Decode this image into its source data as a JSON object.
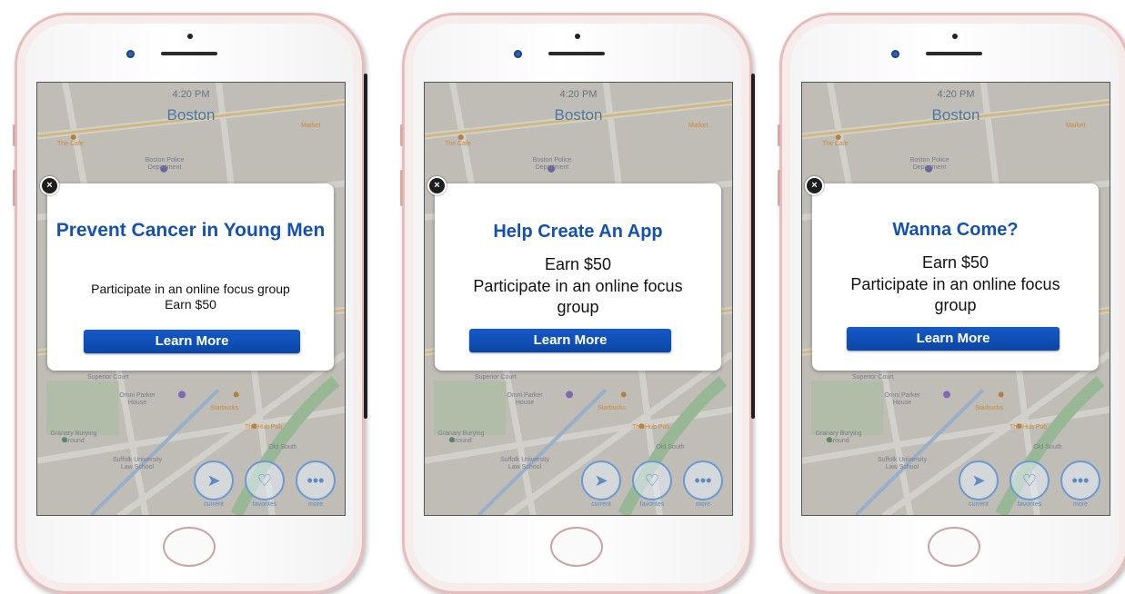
{
  "phones": [
    {
      "status": {
        "time": "4:20 PM",
        "city": "Boston"
      },
      "popup": {
        "close_icon": "close-icon",
        "headline": "Prevent Cancer in Young Men",
        "line1": "Participate in an online focus group",
        "line2": "Earn $50",
        "cta": "Learn More"
      }
    },
    {
      "status": {
        "time": "4:20 PM",
        "city": "Boston"
      },
      "popup": {
        "close_icon": "close-icon",
        "headline": "Help Create An App",
        "line1": "Earn $50",
        "line2": "Participate in an online focus group",
        "cta": "Learn More"
      }
    },
    {
      "status": {
        "time": "4:20 PM",
        "city": "Boston"
      },
      "popup": {
        "close_icon": "close-icon",
        "headline": "Wanna Come?",
        "line1": "Earn $50",
        "line2": "Participate in an online focus group",
        "cta": "Learn More"
      }
    }
  ],
  "map_labels": {
    "cafe": "The Cafe",
    "police": "Boston Police Department",
    "market": "Market",
    "court": "Superior Court",
    "omni": "Omni Parker House",
    "starbucks": "Starbucks",
    "hub": "The Hub Pub",
    "granary": "Granary Burying Ground",
    "suffolk": "Suffolk University Law School",
    "old_south": "Old South"
  },
  "tabbar": {
    "current_label": "current",
    "favorites_label": "favorites",
    "more_label": "more",
    "icons": [
      "location-arrow-icon",
      "heart-icon",
      "more-dots-icon"
    ]
  },
  "colors": {
    "headline_blue": "#1451b5",
    "button_blue": "#0b46a5",
    "phone_rim": "#e6bcbc"
  }
}
